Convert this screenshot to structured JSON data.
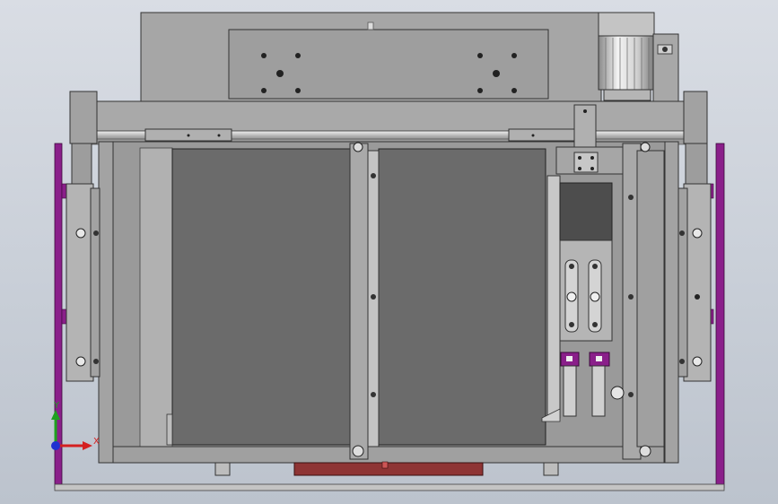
{
  "triad": {
    "x_label": "X",
    "y_label": "Y"
  },
  "colors": {
    "background_top": "#d9dde4",
    "background_bottom": "#bcc3cd",
    "frame_gray": "#9a9a9a",
    "panel_dark": "#6a6a6a",
    "purple": "#8a1f8a",
    "axis_x": "#d42020",
    "axis_y": "#1fa01f",
    "axis_z": "#2030d0"
  }
}
